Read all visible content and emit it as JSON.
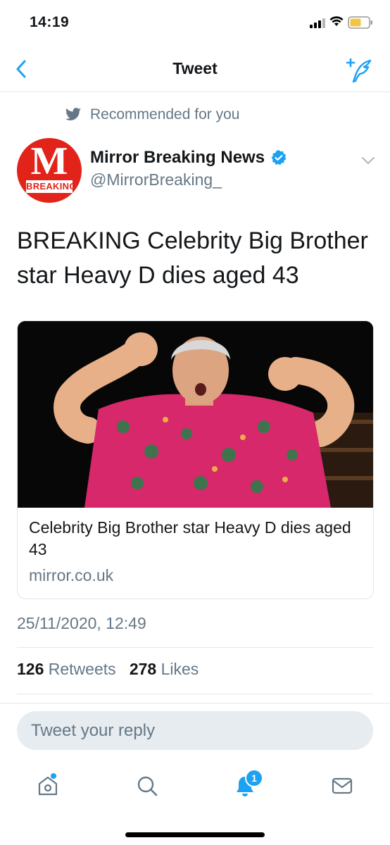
{
  "status": {
    "time": "14:19"
  },
  "nav": {
    "title": "Tweet",
    "back_icon": "chevron-left-icon",
    "compose_icon": "compose-tweet-icon"
  },
  "recommended": {
    "label": "Recommended for you",
    "icon": "twitter-bird-icon"
  },
  "author": {
    "name": "Mirror Breaking News",
    "handle": "@MirrorBreaking_",
    "verified": true,
    "avatar_letter": "M",
    "avatar_text": "BREAKING",
    "avatar_color": "#e2231a"
  },
  "tweet": {
    "text": "BREAKING Celebrity Big Brother star Heavy D dies aged 43",
    "timestamp": "25/11/2020, 12:49"
  },
  "card": {
    "title": "Celebrity Big Brother star Heavy D dies aged 43",
    "domain": "mirror.co.uk"
  },
  "stats": {
    "retweets_count": "126",
    "retweets_label": "Retweets",
    "likes_count": "278",
    "likes_label": "Likes"
  },
  "reply": {
    "placeholder": "Tweet your reply"
  },
  "tabbar": {
    "items": [
      {
        "name": "home",
        "icon": "home-icon"
      },
      {
        "name": "search",
        "icon": "search-icon"
      },
      {
        "name": "notifications",
        "icon": "bell-icon",
        "badge": "1"
      },
      {
        "name": "messages",
        "icon": "mail-icon"
      }
    ]
  },
  "colors": {
    "accent": "#1da1f2",
    "muted": "#657786",
    "text": "#14171a",
    "border": "#e1e8ed"
  }
}
